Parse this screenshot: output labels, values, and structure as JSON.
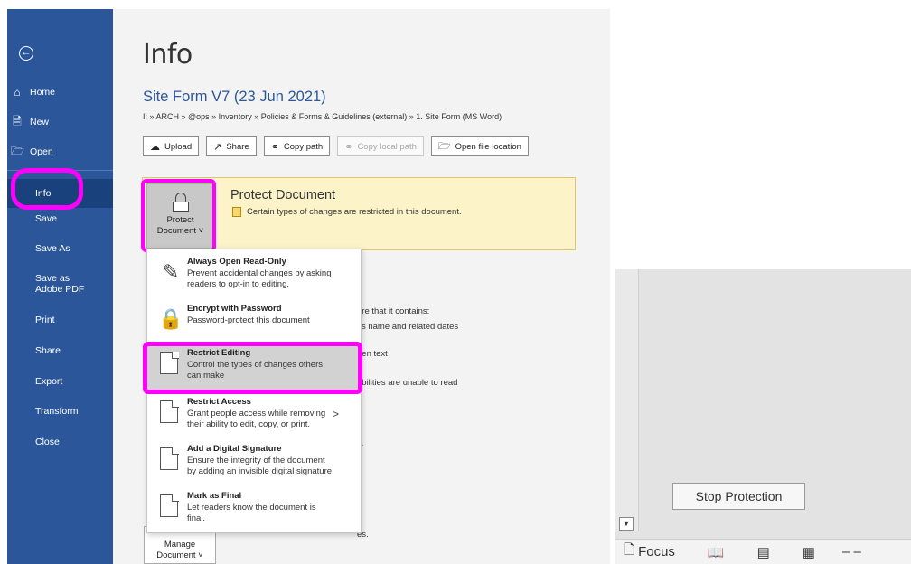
{
  "nav": {
    "back_label": "←",
    "items": [
      {
        "label": "Home",
        "icon": "home-icon"
      },
      {
        "label": "New",
        "icon": "new-document-icon"
      },
      {
        "label": "Open",
        "icon": "open-folder-icon"
      },
      {
        "label": "Info"
      },
      {
        "label": "Save"
      },
      {
        "label": "Save As"
      },
      {
        "label": "Save as Adobe PDF"
      },
      {
        "label": "Print"
      },
      {
        "label": "Share"
      },
      {
        "label": "Export"
      },
      {
        "label": "Transform"
      },
      {
        "label": "Close"
      }
    ]
  },
  "main": {
    "title": "Info",
    "doc_name": "Site Form V7 (23 Jun 2021)",
    "path": "I: » ARCH » @ops » Inventory » Policies & Forms & Guidelines (external) » 1. Site Form (MS Word)",
    "actions": [
      {
        "label": "Upload",
        "icon": "upload-icon"
      },
      {
        "label": "Share",
        "icon": "share-icon"
      },
      {
        "label": "Copy path",
        "icon": "link-icon"
      },
      {
        "label": "Copy local path",
        "icon": "link-icon"
      },
      {
        "label": "Open file location",
        "icon": "folder-icon"
      }
    ],
    "protect": {
      "button_line1": "Protect",
      "button_line2": "Document ˅",
      "title": "Protect Document",
      "desc": "Certain types of changes are restricted in this document."
    },
    "background_lines": [
      "are that it contains:",
      "r's name and related dates",
      "den text",
      "abilities are unable to read",
      "s.",
      "es."
    ],
    "manage_line1": "Manage",
    "manage_line2": "Document ˅"
  },
  "dropdown": [
    {
      "title": "Always Open Read-Only",
      "desc": "Prevent accidental changes by asking readers to opt-in to editing."
    },
    {
      "title": "Encrypt with Password",
      "desc": "Password-protect this document"
    },
    {
      "title": "Restrict Editing",
      "desc": "Control the types of changes others can make"
    },
    {
      "title": "Restrict Access",
      "desc": "Grant people access while removing their ability to edit, copy, or print.",
      "arrow": ">"
    },
    {
      "title": "Add a Digital Signature",
      "desc": "Ensure the integrity of the document by adding an invisible digital signature"
    },
    {
      "title": "Mark as Final",
      "desc": "Let readers know the document is final."
    }
  ],
  "inset": {
    "stop_button": "Stop Protection",
    "scroll_arrow": "▼",
    "focus_label": "Focus"
  },
  "colors": {
    "nav_bg": "#2b579a",
    "highlight": "#ff00ff",
    "protect_bg": "#fcf3c8"
  }
}
